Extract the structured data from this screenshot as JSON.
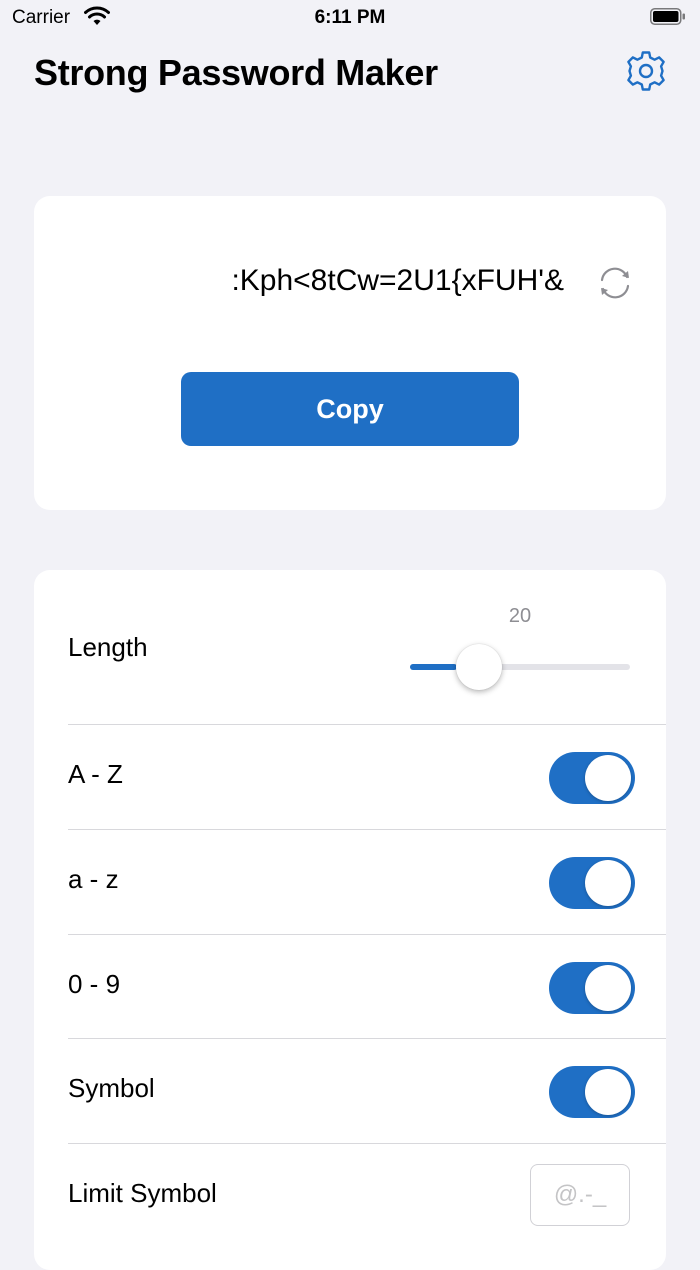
{
  "status_bar": {
    "carrier": "Carrier",
    "time": "6:11 PM"
  },
  "header": {
    "title": "Strong Password Maker",
    "settings_icon": "gear-icon"
  },
  "password_card": {
    "password": ":Kph<8tCw=2U1{xFUH'&",
    "refresh_icon": "refresh-icon",
    "copy_label": "Copy"
  },
  "settings": {
    "length": {
      "label": "Length",
      "value": "20",
      "slider_fraction": 0.2
    },
    "options": [
      {
        "label": "A - Z",
        "enabled": true
      },
      {
        "label": "a - z",
        "enabled": true
      },
      {
        "label": "0 - 9",
        "enabled": true
      },
      {
        "label": "Symbol",
        "enabled": true
      }
    ],
    "limit_symbol": {
      "label": "Limit Symbol",
      "placeholder": "@.-_"
    }
  },
  "colors": {
    "accent": "#1f6fc5",
    "background": "#f2f2f7",
    "card": "#ffffff"
  }
}
